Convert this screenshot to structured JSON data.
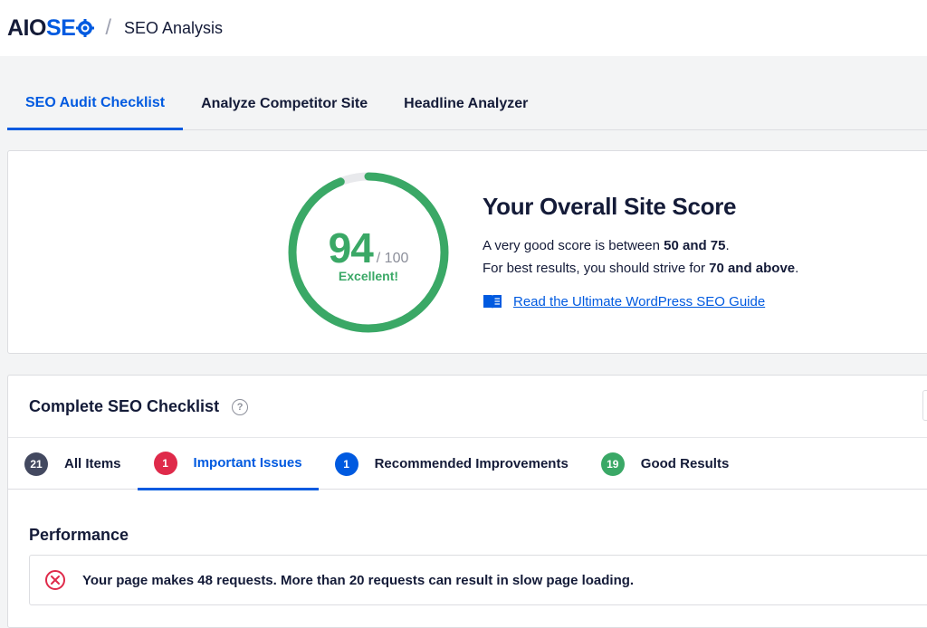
{
  "header": {
    "logo_aio": "AIO",
    "logo_seo": "SE",
    "separator": "/",
    "page_title": "SEO Analysis"
  },
  "main_tabs": [
    {
      "label": "SEO Audit Checklist",
      "active": true
    },
    {
      "label": "Analyze Competitor Site",
      "active": false
    },
    {
      "label": "Headline Analyzer",
      "active": false
    }
  ],
  "score": {
    "value": "94",
    "out_of": "/ 100",
    "rating": "Excellent!",
    "fraction": 0.94,
    "title": "Your Overall Site Score",
    "line1_prefix": "A very good score is between ",
    "line1_bold": "50 and 75",
    "line1_suffix": ".",
    "line2_prefix": "For best results, you should strive for ",
    "line2_bold": "70 and above",
    "line2_suffix": ".",
    "guide_link": "Read the Ultimate WordPress SEO Guide"
  },
  "checklist": {
    "title": "Complete SEO Checklist",
    "tabs": [
      {
        "count": "21",
        "label": "All Items",
        "color": "#434960",
        "active": false
      },
      {
        "count": "1",
        "label": "Important Issues",
        "color": "#df2a4a",
        "active": true
      },
      {
        "count": "1",
        "label": "Recommended Improvements",
        "color": "#005ae0",
        "active": false
      },
      {
        "count": "19",
        "label": "Good Results",
        "color": "#3aa866",
        "active": false
      }
    ],
    "section_title": "Performance",
    "issue_text": "Your page makes 48 requests. More than 20 requests can result in slow page loading."
  },
  "colors": {
    "accent": "#005ae0",
    "success": "#3aa866",
    "error": "#df2a4a",
    "dark": "#141b38"
  },
  "icons": {
    "logo": "gear-icon",
    "help": "question-circle-icon",
    "guide": "book-icon",
    "issue": "error-x-circle-icon"
  }
}
